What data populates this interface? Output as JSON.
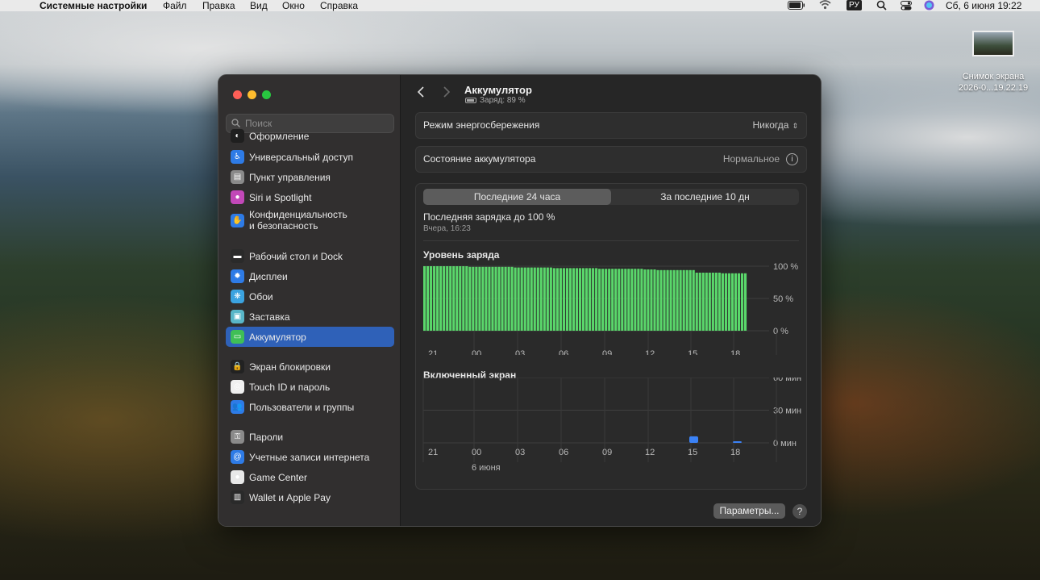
{
  "menubar": {
    "app_name": "Системные настройки",
    "menus": [
      "Файл",
      "Правка",
      "Вид",
      "Окно",
      "Справка"
    ],
    "keyboard_layout": "РУ",
    "datetime": "Сб, 6 июня  19:22"
  },
  "desktop": {
    "screenshot_label_1": "Снимок экрана",
    "screenshot_label_2": "2026-0...19.22.19"
  },
  "sidebar": {
    "search_placeholder": "Поиск",
    "items": [
      {
        "label": "Оформление",
        "icon": "appearance-icon",
        "color": "#1f1f1f"
      },
      {
        "label": "Универсальный доступ",
        "icon": "accessibility-icon",
        "color": "#2e7be6"
      },
      {
        "label": "Пункт управления",
        "icon": "control-center-icon",
        "color": "#8a8a8a"
      },
      {
        "label": "Siri и Spotlight",
        "icon": "siri-icon",
        "color": "#c248b8"
      },
      {
        "label": "Конфиденциальность",
        "label2": "и безопасность",
        "icon": "privacy-hand-icon",
        "color": "#2e7be6"
      },
      {
        "label": "Рабочий стол и Dock",
        "icon": "dock-icon",
        "color": "#2a2a2a"
      },
      {
        "label": "Дисплеи",
        "icon": "displays-icon",
        "color": "#2e7be6"
      },
      {
        "label": "Обои",
        "icon": "wallpaper-icon",
        "color": "#3ba3e0"
      },
      {
        "label": "Заставка",
        "icon": "screensaver-icon",
        "color": "#59b6c8"
      },
      {
        "label": "Аккумулятор",
        "icon": "battery-icon",
        "color": "#3fbf56",
        "active": true
      },
      {
        "label": "Экран блокировки",
        "icon": "lock-screen-icon",
        "color": "#222"
      },
      {
        "label": "Touch ID и пароль",
        "icon": "touch-id-icon",
        "color": "#f0f0f0"
      },
      {
        "label": "Пользователи и группы",
        "icon": "users-icon",
        "color": "#2e7be6"
      },
      {
        "label": "Пароли",
        "icon": "key-icon",
        "color": "#8a8a8a"
      },
      {
        "label": "Учетные записи интернета",
        "icon": "at-icon",
        "color": "#2e7be6"
      },
      {
        "label": "Game Center",
        "icon": "game-center-icon",
        "color": "#e8e8e8"
      },
      {
        "label": "Wallet и Apple Pay",
        "icon": "wallet-icon",
        "color": "#2a2a2a"
      }
    ]
  },
  "main": {
    "title": "Аккумулятор",
    "subtitle": "Заряд: 89 %",
    "power_mode_label": "Режим энергосбережения",
    "power_mode_value": "Никогда",
    "battery_health_label": "Состояние аккумулятора",
    "battery_health_value": "Нормальное",
    "tabs": [
      "Последние 24 часа",
      "За последние 10 дн"
    ],
    "last_charge": "Последняя зарядка до 100 %",
    "last_charge_time": "Вчера, 16:23",
    "settings_button": "Параметры...",
    "help_button": "?"
  },
  "chart_data": [
    {
      "type": "bar",
      "title": "Уровень заряда",
      "x_tick_labels": [
        "21",
        "00",
        "03",
        "06",
        "09",
        "12",
        "15",
        "18"
      ],
      "y_tick_labels": [
        "100 %",
        "50 %",
        "0 %"
      ],
      "ylim": [
        0,
        100
      ],
      "color": "#5ad76b",
      "values": [
        100,
        100,
        100,
        100,
        100,
        100,
        100,
        100,
        100,
        100,
        100,
        100,
        100,
        100,
        99,
        99,
        99,
        99,
        99,
        99,
        99,
        99,
        99,
        99,
        99,
        99,
        99,
        99,
        98,
        98,
        98,
        98,
        98,
        98,
        98,
        98,
        98,
        98,
        98,
        98,
        97,
        97,
        97,
        97,
        97,
        97,
        97,
        97,
        97,
        97,
        97,
        97,
        97,
        97,
        96,
        96,
        96,
        96,
        96,
        96,
        96,
        96,
        96,
        96,
        96,
        96,
        96,
        96,
        95,
        95,
        95,
        95,
        94,
        94,
        94,
        94,
        94,
        94,
        94,
        94,
        94,
        94,
        94,
        94,
        90,
        90,
        90,
        90,
        90,
        90,
        90,
        90,
        89,
        89,
        89,
        89,
        89,
        89,
        89,
        89
      ]
    },
    {
      "type": "bar",
      "title": "Включенный экран",
      "x_tick_labels": [
        "21",
        "00",
        "03",
        "06",
        "09",
        "12",
        "15",
        "18"
      ],
      "x_sublabel": "6 июня",
      "y_tick_labels": [
        "60 мин",
        "30 мин",
        "0 мин"
      ],
      "ylim": [
        0,
        60
      ],
      "color": "#3b82f6",
      "hours": [
        "15-16",
        "18-19"
      ],
      "values": [
        6,
        1
      ]
    }
  ]
}
